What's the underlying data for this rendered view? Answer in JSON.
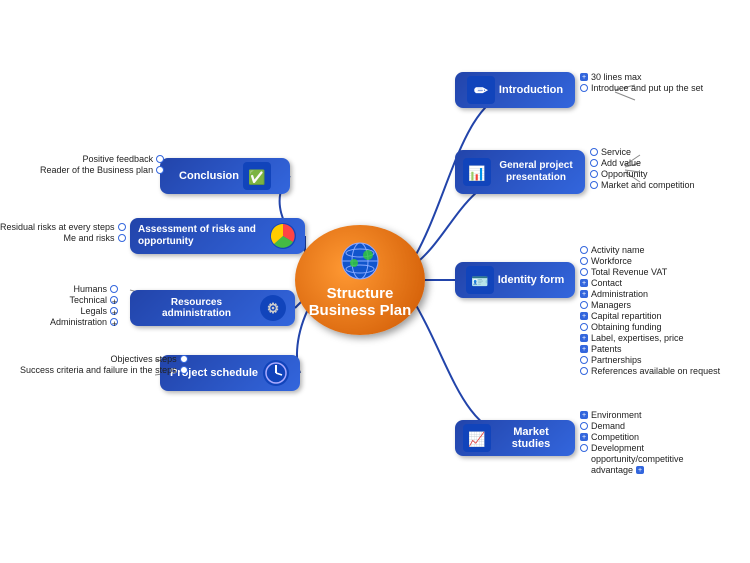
{
  "mindmap": {
    "central": {
      "line1": "Structure",
      "line2": "Business Plan"
    },
    "nodes": {
      "introduction": {
        "label": "Introduction",
        "sub": [
          "30 lines max",
          "Introduce and put up the set"
        ]
      },
      "general": {
        "label": "General project presentation",
        "sub": [
          "Service",
          "Add value",
          "Opportunity",
          "Market and competition"
        ]
      },
      "identity": {
        "label": "Identity form",
        "sub": [
          "Activity name",
          "Workforce",
          "Total Revenue VAT",
          "Contact",
          "Administration",
          "Managers",
          "Capital repartition",
          "Obtaining funding",
          "Label, expertises, price",
          "Patents",
          "Partnerships",
          "References available on request"
        ]
      },
      "market": {
        "label": "Market studies",
        "sub": [
          "Environment",
          "Demand",
          "Competition",
          "Development opportunity/competitive advantage"
        ]
      },
      "conclusion": {
        "label": "Conclusion",
        "sub_left": [
          "Positive feedback",
          "Reader of the Business plan"
        ]
      },
      "assessment": {
        "label": "Assessment of risks and opportunity",
        "sub_left": [
          "Residual risks at every steps",
          "Me and risks"
        ]
      },
      "resources": {
        "label": "Resources administration",
        "sub_left": [
          "Humans",
          "Technical",
          "Legals",
          "Administration"
        ]
      },
      "schedule": {
        "label": "Project schedule",
        "sub_left": [
          "Objectives steps",
          "Success criteria and failure in the steps"
        ]
      }
    }
  }
}
